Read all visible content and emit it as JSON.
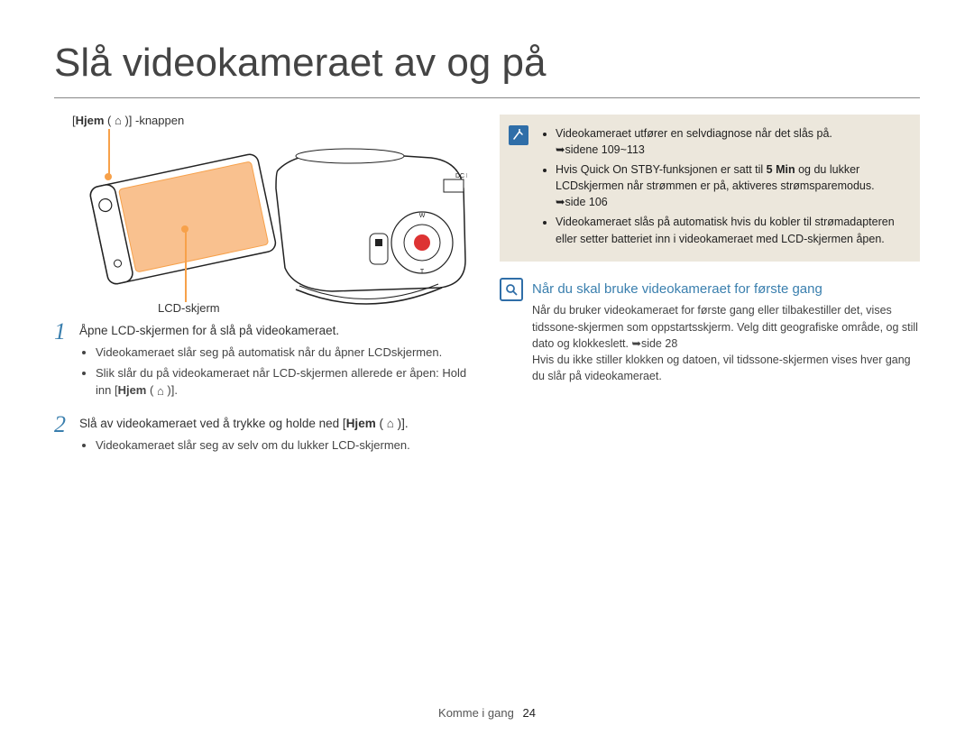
{
  "title": "Slå videokameraet av og på",
  "diagram": {
    "label_home_pre": "[",
    "label_home_bold": "Hjem",
    "label_home_post": " ( ⌂ )] -knappen",
    "label_lcd": "LCD-skjerm"
  },
  "steps": [
    {
      "text": "Åpne LCD-skjermen for å slå på videokameraet.",
      "bullets": [
        "Videokameraet slår seg på automatisk når du åpner LCDskjermen.",
        "Slik slår du på videokameraet når LCD-skjermen allerede er åpen: Hold inn [Hjem ( ⌂ )]."
      ]
    },
    {
      "text_pre": "Slå av videokameraet ved å trykke og holde ned [",
      "text_bold": "Hjem",
      "text_post": " ( ⌂ )].",
      "bullets": [
        "Videokameraet slår seg av selv om du lukker LCD-skjermen."
      ]
    }
  ],
  "note": {
    "items": [
      {
        "text": "Videokameraet utfører en selvdiagnose når det slås på.",
        "ref": "➥sidene 109~113"
      },
      {
        "text_pre": "Hvis Quick On STBY-funksjonen er satt til ",
        "text_bold": "5 Min",
        "text_post": " og du lukker LCDskjermen når strømmen er på, aktiveres strømsparemodus.",
        "ref": "➥side 106"
      },
      {
        "text": "Videokameraet slås på automatisk hvis du kobler til strømadapteren eller setter batteriet inn i videokameraet med LCD-skjermen åpen."
      }
    ]
  },
  "first_time": {
    "heading": "Når du skal bruke videokameraet for første gang",
    "p1_pre": "Når du bruker videokameraet for første gang eller tilbakestiller det, vises tidssone-skjermen som oppstartsskjerm. Velg ditt geografiske område, og still dato og klokkeslett. ",
    "p1_ref": "➥side 28",
    "p2": "Hvis du ikke stiller klokken og datoen, vil tidssone-skjermen vises hver gang du slår på videokameraet."
  },
  "footer": {
    "section": "Komme i gang",
    "page": "24"
  }
}
